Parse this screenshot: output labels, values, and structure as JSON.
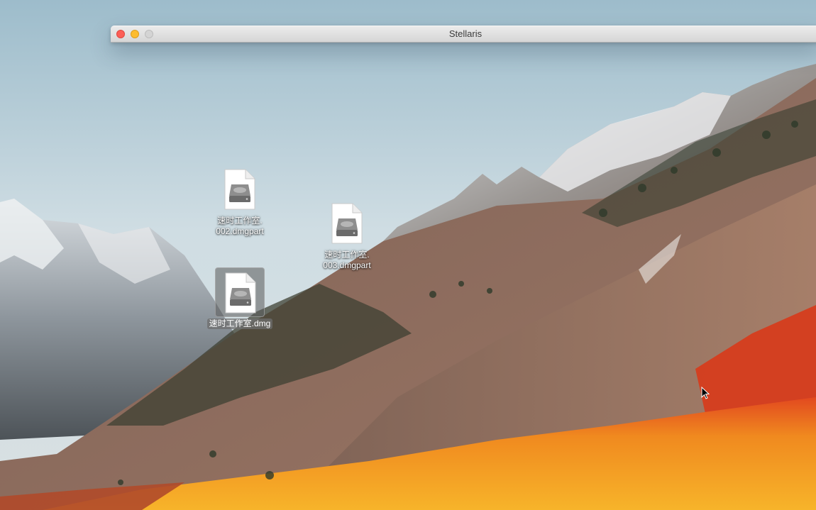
{
  "window": {
    "title": "Stellaris"
  },
  "desktop_icons": [
    {
      "line1": "速时工作室.",
      "line2": "002.dmgpart",
      "icon": "disk-image-file-icon",
      "selected": false
    },
    {
      "line1": "速时工作室.",
      "line2": "003.dmgpart",
      "icon": "disk-image-file-icon",
      "selected": false
    },
    {
      "line1": "速时工作室.dmg",
      "line2": "",
      "icon": "disk-image-file-icon",
      "selected": true
    }
  ],
  "colors": {
    "close": "#fc5f57",
    "minimize": "#fdbc2e",
    "zoom_disabled": "#d4d4d4",
    "selection": "#6e6e6e"
  }
}
